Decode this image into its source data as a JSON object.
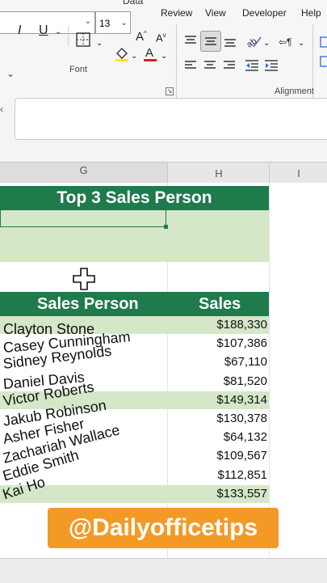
{
  "ribbon": {
    "tab_data": "Data",
    "tabs": [
      "Review",
      "View",
      "Developer",
      "Help"
    ],
    "font_size": "13",
    "font_group_label": "Font",
    "alignment_group_label": "Alignment",
    "font_buttons": {
      "italic": "I",
      "underline": "U",
      "grow": "A",
      "shrink": "A"
    }
  },
  "columns": [
    "G",
    "H",
    "I"
  ],
  "summary": {
    "title": "Top 3 Sales Person"
  },
  "table": {
    "headers": {
      "name": "Sales Person",
      "sales": "Sales"
    },
    "rows": [
      {
        "name": "Clayton Stone",
        "sales": "$188,330",
        "highlight": true
      },
      {
        "name": "Casey Cunningham",
        "sales": "$107,386",
        "highlight": false
      },
      {
        "name": "Sidney Reynolds",
        "sales": "$67,110",
        "highlight": false
      },
      {
        "name": "Daniel Davis",
        "sales": "$81,520",
        "highlight": false
      },
      {
        "name": "Victor Roberts",
        "sales": "$149,314",
        "highlight": true
      },
      {
        "name": "Jakub Robinson",
        "sales": "$130,378",
        "highlight": false
      },
      {
        "name": "Asher Fisher",
        "sales": "$64,132",
        "highlight": false
      },
      {
        "name": "Zachariah Wallace",
        "sales": "$109,567",
        "highlight": false
      },
      {
        "name": "Eddie Smith",
        "sales": "$112,851",
        "highlight": false
      },
      {
        "name": "Kai Ho",
        "sales": "$133,557",
        "highlight": true
      }
    ]
  },
  "watermark": "@Dailyofficetips",
  "colors": {
    "accent": "#1f7a4c",
    "band": "#d4e8c7",
    "watermark": "#f39a26"
  }
}
